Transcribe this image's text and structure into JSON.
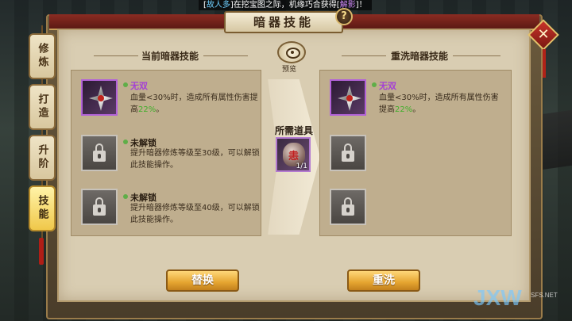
{
  "announcement": {
    "prefix": "[",
    "name": "故人多",
    "middle": "]在挖宝图之际，机缘巧合获得[",
    "item": "解影",
    "suffix": "]！"
  },
  "window": {
    "title": "暗器技能",
    "help_label": "?",
    "close_label": "✕"
  },
  "tabs": [
    {
      "label": "修炼",
      "active": false
    },
    {
      "label": "打造",
      "active": false
    },
    {
      "label": "升阶",
      "active": false
    },
    {
      "label": "技能",
      "active": true
    }
  ],
  "left_panel": {
    "title": "当前暗器技能",
    "skills": [
      {
        "name": "无双",
        "desc_before": "血量<30%时，造成所有属性伤害提高",
        "desc_value": "22%",
        "desc_after": "。",
        "locked": false
      },
      {
        "name": "未解锁",
        "desc": "提升暗器修炼等级至30级，可以解锁此技能操作。",
        "locked": true
      },
      {
        "name": "未解锁",
        "desc": "提升暗器修炼等级至40级，可以解锁此技能操作。",
        "locked": true
      }
    ]
  },
  "middle": {
    "preview_label": "预览",
    "required_label": "所需道具",
    "item_glyph": "恚",
    "item_count": "1/1"
  },
  "right_panel": {
    "title": "重洗暗器技能",
    "skill": {
      "name": "无双",
      "desc_before": "血量<30%时，造成所有属性伤害提高",
      "desc_value": "22%",
      "desc_after": "。"
    }
  },
  "buttons": {
    "replace": "替换",
    "reroll": "重洗"
  },
  "watermark": {
    "logo": "JXW",
    "site": "SFS.NET"
  }
}
